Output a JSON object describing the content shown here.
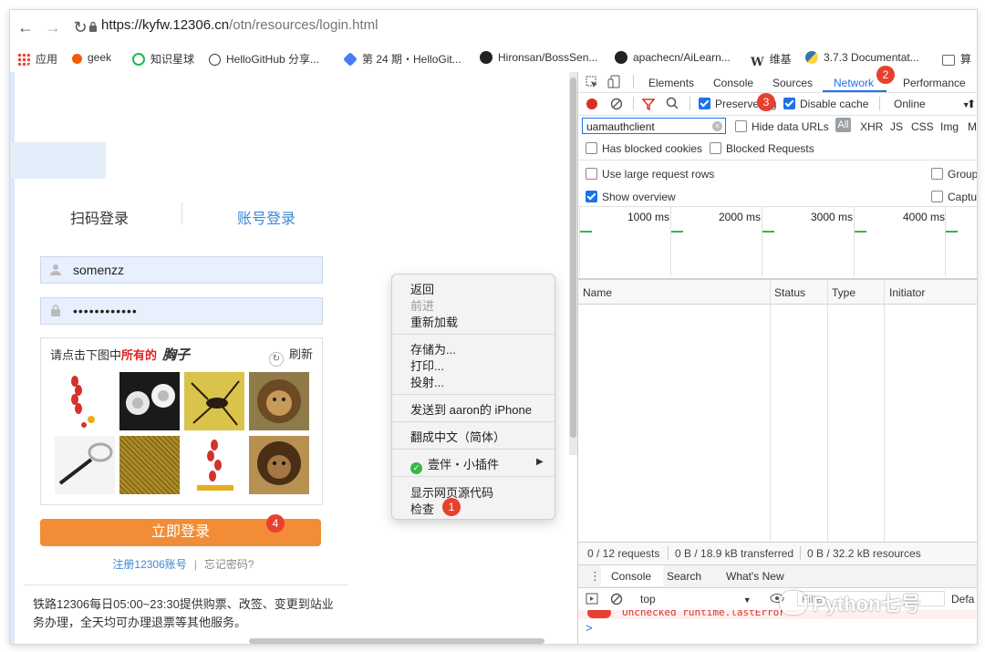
{
  "browser": {
    "url_host": "https://kyfw.12306.cn",
    "url_path": "/otn/resources/login.html",
    "bookmarks": [
      {
        "label": "应用",
        "icon": "apps-grid-icon",
        "color": "#4285f4"
      },
      {
        "label": "geek",
        "icon": "geek-icon",
        "color": "#f25c05"
      },
      {
        "label": "知识星球",
        "icon": "planet-icon",
        "color": "#19b955"
      },
      {
        "label": "HelloGitHub 分享...",
        "icon": "hellogithub-icon",
        "color": "#333333"
      },
      {
        "label": "第 24 期・HelloGit...",
        "icon": "layers-icon",
        "color": "#4a7cf7"
      },
      {
        "label": "Hironsan/BossSen...",
        "icon": "github-icon",
        "color": "#222222"
      },
      {
        "label": "apachecn/AiLearn...",
        "icon": "github-icon",
        "color": "#222222"
      },
      {
        "label": "维基",
        "icon": "wikipedia-icon",
        "color": "#222222"
      },
      {
        "label": "3.7.3 Documentat...",
        "icon": "python-icon",
        "color": "#3776ab"
      },
      {
        "label": "算",
        "icon": "folder-icon",
        "color": "#666666"
      }
    ]
  },
  "login": {
    "tab_qr": "扫码登录",
    "tab_account": "账号登录",
    "username": "somenzz",
    "password": "••••••••••••",
    "captcha_prefix": "请点击下图中",
    "captcha_emph": "所有的",
    "captcha_word": "胸子",
    "captcha_refresh": "刷新",
    "login_button": "立即登录",
    "register_link": "注册12306账号",
    "separator": "|",
    "forgot_link": "忘记密码?",
    "notice": "铁路12306每日05:00~23:30提供购票、改签、变更到站业务办理，全天均可办理退票等其他服务。"
  },
  "context_menu": {
    "items": [
      "返回",
      "前进",
      "重新加载",
      "存储为...",
      "打印...",
      "投射...",
      "发送到 aaron的 iPhone",
      "翻成中文（简体）",
      "壹伴・小插件",
      "显示网页源代码",
      "检查"
    ]
  },
  "badges": {
    "b1": "1",
    "b2": "2",
    "b3": "3",
    "b4": "4"
  },
  "devtools": {
    "tabs": [
      "Elements",
      "Console",
      "Sources",
      "Network",
      "Performance"
    ],
    "active_tab": "Network",
    "preserve_log": "Preserve log",
    "disable_cache": "Disable cache",
    "throttle": "Online",
    "filter_value": "uamauthclient",
    "hide_data_urls": "Hide data URLs",
    "type_filters": [
      "All",
      "XHR",
      "JS",
      "CSS",
      "Img",
      "M"
    ],
    "has_blocked_cookies": "Has blocked cookies",
    "blocked_requests": "Blocked Requests",
    "large_rows": "Use large request rows",
    "show_overview": "Show overview",
    "group": "Group",
    "capture": "Captu",
    "ticks": [
      "1000 ms",
      "2000 ms",
      "3000 ms",
      "4000 ms"
    ],
    "columns": [
      "Name",
      "Status",
      "Type",
      "Initiator"
    ],
    "requests": "0 / 12 requests",
    "transferred": "0 B / 18.9 kB transferred",
    "resources": "0 B / 32.2 kB resources",
    "drawer_tabs": [
      "Console",
      "Search",
      "What's New"
    ],
    "context": "top",
    "filter_placeholder": "Filter",
    "default_levels": "Defa",
    "error_text": "Unchecked runtime.lastError",
    "prompt": ">"
  },
  "watermark": "Python七号",
  "colors": {
    "accent": "#1a73e8",
    "orange": "#f28c37",
    "badge": "#e8402f"
  }
}
